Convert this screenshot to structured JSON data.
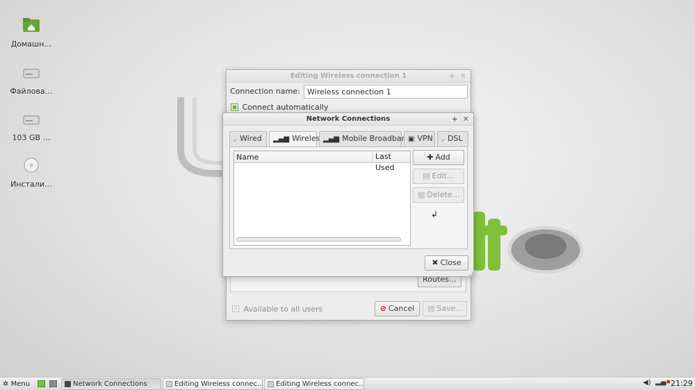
{
  "desktop": {
    "icons": [
      {
        "label": "Домашн…",
        "icon": "home-folder-icon"
      },
      {
        "label": "Файлова…",
        "icon": "drive-icon"
      },
      {
        "label": "103 GB …",
        "icon": "drive-icon"
      },
      {
        "label": "Инстали…",
        "icon": "disc-icon"
      }
    ]
  },
  "editing_window": {
    "title": "Editing Wireless connection 1",
    "connection_name_label": "Connection name:",
    "connection_name_value": "Wireless connection 1",
    "connect_automatically_label": "Connect automatically",
    "connect_automatically_checked": true,
    "routes_button": "Routes…",
    "available_to_all_users_label": "Available to all users",
    "available_to_all_users_checked": false,
    "cancel_button": "Cancel",
    "save_button": "Save…"
  },
  "network_window": {
    "title": "Network Connections",
    "tabs": [
      {
        "label": "Wired",
        "icon": "ethernet-icon",
        "active": false
      },
      {
        "label": "Wireless",
        "icon": "signal-bars-icon",
        "active": true
      },
      {
        "label": "Mobile Broadband",
        "icon": "signal-bars-icon",
        "active": false
      },
      {
        "label": "VPN",
        "icon": "lock-icon",
        "active": false
      },
      {
        "label": "DSL",
        "icon": "ethernet-icon",
        "active": false
      }
    ],
    "table": {
      "columns": [
        "Name",
        "Last Used"
      ],
      "rows": []
    },
    "add_button": "Add",
    "edit_button": "Edit…",
    "delete_button": "Delete…",
    "close_button": "Close"
  },
  "taskbar": {
    "menu_label": "Menu",
    "tasks": [
      {
        "label": "Network Connections",
        "active": true
      },
      {
        "label": "Editing Wireless connec…",
        "active": false
      },
      {
        "label": "Editing Wireless connec…",
        "active": false
      }
    ],
    "clock": "21:29"
  },
  "colors": {
    "mint_green": "#8ac43f",
    "cancel_red": "#cc0000"
  }
}
